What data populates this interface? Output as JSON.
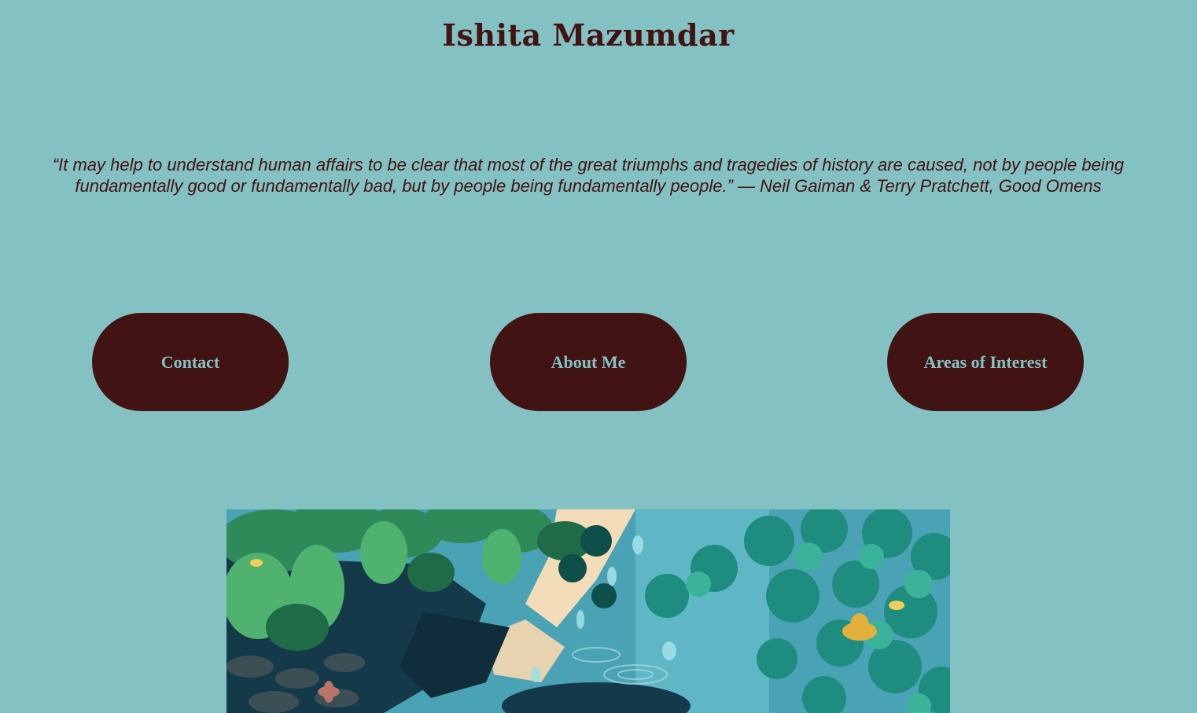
{
  "header": {
    "title": "Ishita Mazumdar"
  },
  "quote": {
    "text": "“It may help to understand human affairs to be clear that most of the great triumphs and tragedies of history are caused, not by people being fundamentally good or fundamentally bad, but by people being fundamentally people.” — Neil Gaiman & Terry Pratchett, Good Omens"
  },
  "nav": {
    "contact_label": "Contact",
    "about_label": "About Me",
    "areas_label": "Areas of Interest"
  },
  "colors": {
    "background": "#84c1c2",
    "accent": "#421313"
  }
}
